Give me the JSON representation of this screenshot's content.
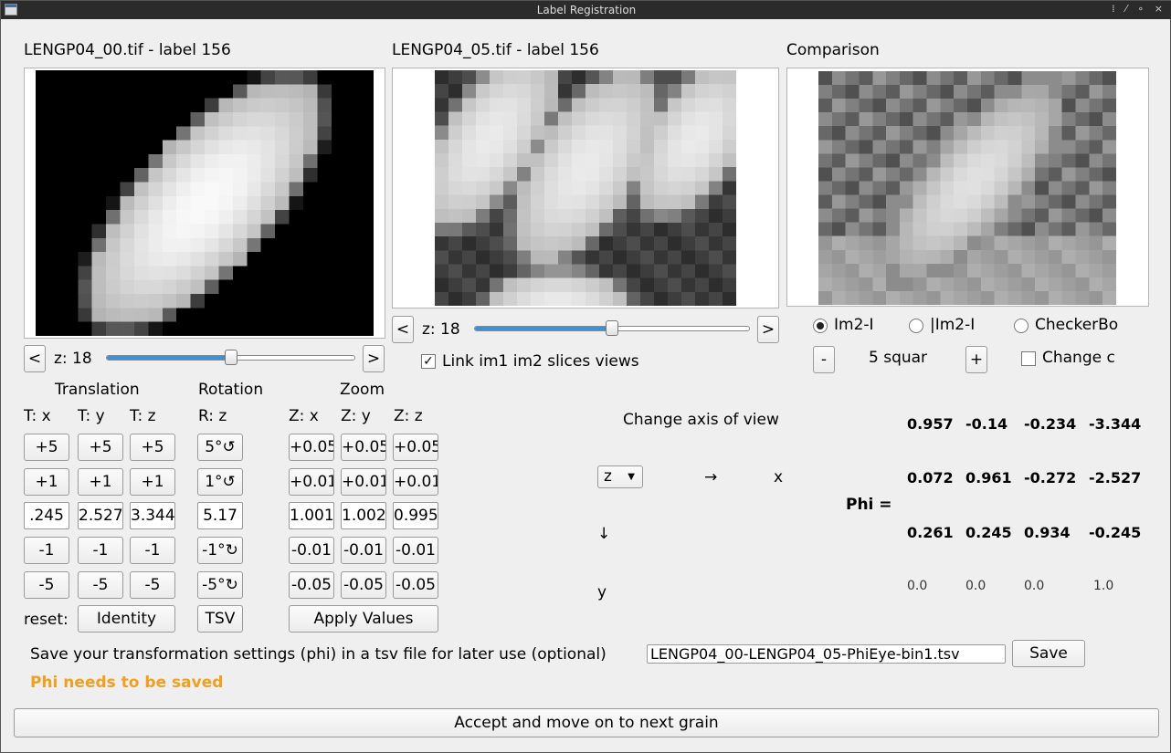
{
  "window": {
    "title": "Label Registration"
  },
  "panels": {
    "im1_title": "LENGP04_00.tif - label 156",
    "im2_title": "LENGP04_05.tif - label 156",
    "cmp_title": "Comparison"
  },
  "slice1": {
    "prev": "<",
    "next": ">",
    "label": "z: 18",
    "level": 0.5
  },
  "slice2": {
    "prev": "<",
    "next": ">",
    "label": "z: 18",
    "level": 0.5
  },
  "link_views": {
    "label": "Link im1 im2 slices views",
    "checked": "✓"
  },
  "comparison": {
    "mode1": "Im2-I",
    "mode2": "|Im2-I",
    "mode3": "CheckerBo",
    "minus": "-",
    "plus": "+",
    "squares": "5 squar",
    "change_label": "Change c"
  },
  "groups": {
    "translation": "Translation",
    "rotation": "Rotation",
    "zoom": "Zoom"
  },
  "columns": {
    "tx": "T: x",
    "ty": "T: y",
    "tz": "T: z",
    "rz": "R: z",
    "zx": "Z: x",
    "zy": "Z: y",
    "zz": "Z: z"
  },
  "steps": {
    "t_p5": "+5",
    "t_p1": "+1",
    "t_m1": "-1",
    "t_m5": "-5",
    "r_p5": "5°↺",
    "r_p1": "1°↺",
    "r_m1": "-1°↻",
    "r_m5": "-5°↻",
    "z_p05": "+0.05",
    "z_p01": "+0.01",
    "z_m01": "-0.01",
    "z_m05": "-0.05"
  },
  "values": {
    "tx": ".245",
    "ty": "2.527",
    "tz": "3.344",
    "rz": "5.17",
    "zx": "1.001",
    "zy": "1.002",
    "zz": "0.995"
  },
  "reset": {
    "label": "reset:",
    "identity": "Identity",
    "tsv": "TSV",
    "apply": "Apply Values"
  },
  "axis": {
    "title": "Change axis of view",
    "selected": "z",
    "right_arrow": "→",
    "x_label": "x",
    "down_arrow": "↓",
    "y_label": "y"
  },
  "phi": {
    "label": "Phi =",
    "rows": [
      [
        "0.957",
        "-0.14",
        "-0.234",
        "-3.344"
      ],
      [
        "0.072",
        "0.961",
        "-0.272",
        "-2.527"
      ],
      [
        "0.261",
        "0.245",
        "0.934",
        "-0.245"
      ],
      [
        "0.0",
        "0.0",
        "0.0",
        "1.0"
      ]
    ]
  },
  "save": {
    "prompt": "Save your transformation settings (phi) in a tsv file for later use (optional)",
    "filename": "LENGP04_00-LENGP04_05-PhiEye-bin1.tsv",
    "button": "Save",
    "status": "Phi needs to be saved"
  },
  "accept": {
    "label": "Accept and move on to next grain"
  },
  "colors": {
    "accent": "#3d8fd6",
    "warning": "#f0a020"
  },
  "icons": {
    "app": "app-window-icon",
    "dropdown": "chevron-down-icon"
  }
}
